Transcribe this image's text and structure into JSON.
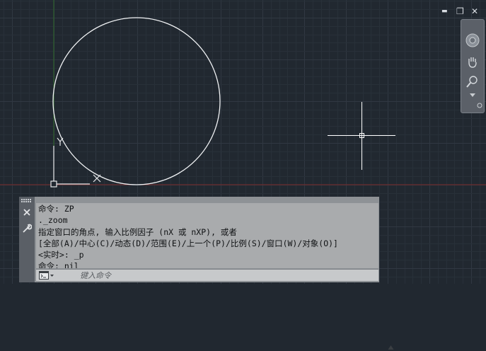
{
  "window": {
    "minimize_glyph": "▬",
    "restore_glyph": "❐",
    "close_glyph": "✕"
  },
  "ucs": {
    "x_label": "X",
    "y_label": "Y"
  },
  "command_history": [
    "命令: ZP",
    "._zoom",
    "指定窗口的角点, 输入比例因子 (nX 或 nXP), 或者",
    "[全部(A)/中心(C)/动态(D)/范围(E)/上一个(P)/比例(S)/窗口(W)/对象(O)]",
    "<实时>: _p",
    "命令: nil"
  ],
  "command_input": {
    "placeholder": "键入命令",
    "value": ""
  },
  "icons": {
    "close": "close-icon",
    "customize": "wrench-icon",
    "grip": "grip-icon",
    "prompt": "command-prompt-icon",
    "scroll": "scroll-up-icon",
    "nav_steering": "steering-wheel-icon",
    "nav_pan": "pan-hand-icon",
    "nav_zoom": "zoom-icon"
  },
  "colors": {
    "background": "#212830",
    "grid_minor": "#283039",
    "grid_major": "#303842",
    "x_axis": "#7a2a2a",
    "y_axis": "#2f6a2a",
    "entity": "#ffffff",
    "panel": "#8e9296"
  }
}
